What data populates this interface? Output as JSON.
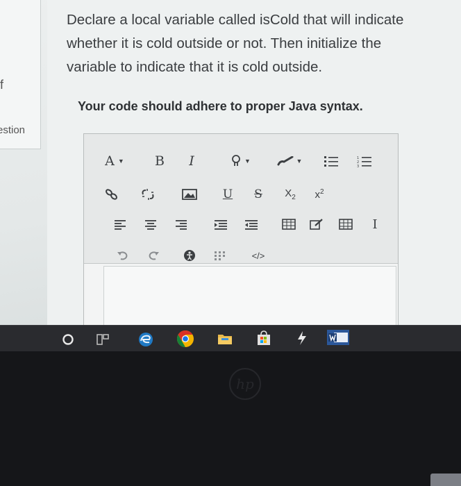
{
  "left_panel": {
    "fragment_top": "f",
    "fragment_label": "estion"
  },
  "question": {
    "prompt_line1": "Declare a local variable called isCold that will indicate",
    "prompt_line2": "whether it is cold outside or not. Then initialize the",
    "prompt_line3": "variable to indicate that it is cold outside.",
    "syntax_note": "Your code should adhere to proper Java syntax."
  },
  "toolbar": {
    "font_color_label": "A",
    "bold_label": "B",
    "italic_label": "I",
    "underline_label": "U",
    "strike_label": "S",
    "subscript_label": "X",
    "subscript_mark": "2",
    "superscript_label": "x",
    "superscript_mark": "2",
    "clear_format_label": "I",
    "code_label": "</>",
    "icons": [
      "font-color-icon",
      "bold-icon",
      "italic-icon",
      "highlight-icon",
      "paint-brush-icon",
      "bulleted-list-icon",
      "numbered-list-icon",
      "link-icon",
      "unlink-icon",
      "image-icon",
      "underline-icon",
      "strikethrough-icon",
      "subscript-icon",
      "superscript-icon",
      "align-left-icon",
      "align-center-icon",
      "align-right-icon",
      "indent-icon",
      "outdent-icon",
      "table-icon",
      "edit-icon",
      "grid-icon",
      "clear-format-icon",
      "undo-icon",
      "redo-icon",
      "accessibility-icon",
      "special-chars-icon",
      "code-icon"
    ]
  },
  "taskbar": {
    "icons": [
      "start-icon",
      "task-view-icon",
      "edge-icon",
      "chrome-icon",
      "file-explorer-icon",
      "store-icon",
      "app-icon",
      "word-icon"
    ]
  },
  "colors": {
    "chrome_red": "#d93025",
    "chrome_green": "#188038",
    "chrome_yellow": "#f4b400",
    "edge_blue": "#1f79c4",
    "word_blue": "#2b579a"
  }
}
